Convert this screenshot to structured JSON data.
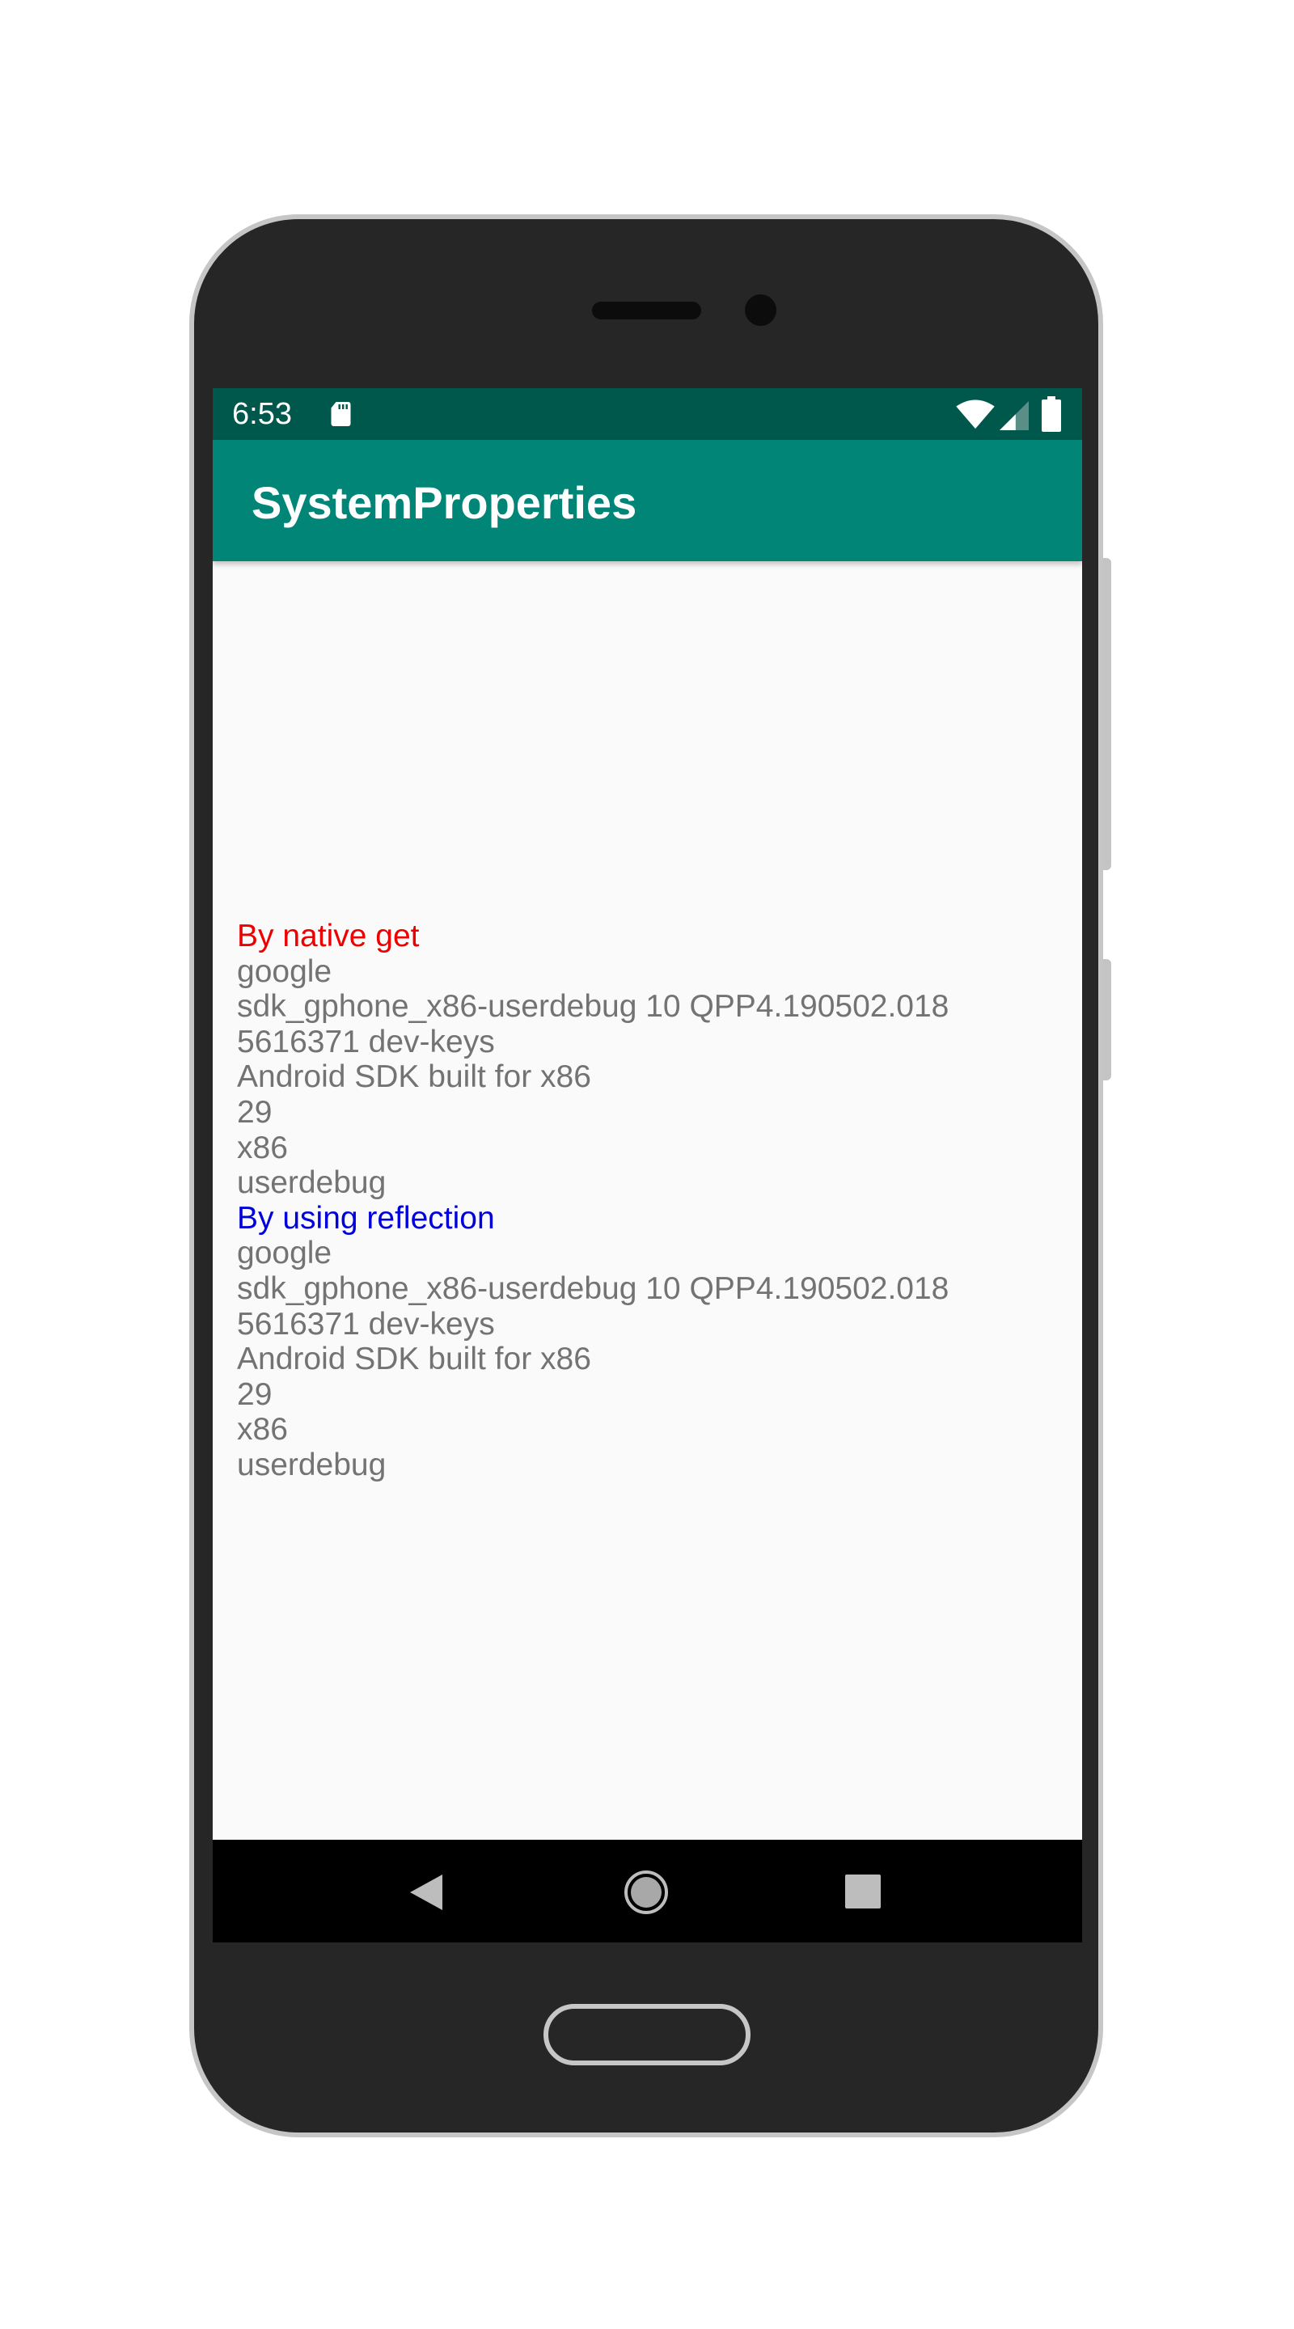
{
  "status_bar": {
    "time": "6:53",
    "icons": [
      "sd-card-icon",
      "wifi-icon",
      "cell-signal-icon",
      "battery-icon"
    ],
    "background": "#00574b"
  },
  "app_bar": {
    "title": "SystemProperties",
    "background": "#008577"
  },
  "content": {
    "native_header": "By native get",
    "native_lines": [
      "google",
      "sdk_gphone_x86-userdebug 10 QPP4.190502.018",
      "5616371 dev-keys",
      "Android SDK built for x86",
      "29",
      "x86",
      "userdebug"
    ],
    "reflection_header": "By using reflection",
    "reflection_lines": [
      "google",
      "sdk_gphone_x86-userdebug 10 QPP4.190502.018",
      "5616371 dev-keys",
      "Android SDK built for x86",
      "29",
      "x86",
      "userdebug"
    ],
    "colors": {
      "native_header": "#ee0000",
      "reflection_header": "#0000dd",
      "body_text": "#737373"
    }
  },
  "nav_bar": {
    "icons": [
      "back-icon",
      "home-icon",
      "recents-icon"
    ]
  }
}
